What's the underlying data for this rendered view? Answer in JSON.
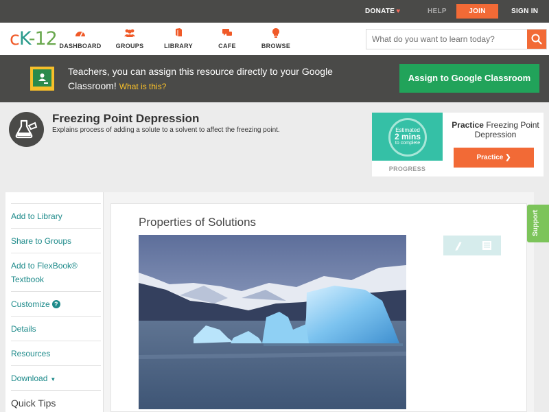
{
  "topbar": {
    "donate": "DONATE",
    "help": "HELP",
    "join": "JOIN",
    "sign_in": "SIGN IN"
  },
  "header": {
    "logo": {
      "c": "c",
      "k": "K",
      "dash": "-",
      "num": "12"
    },
    "nav": [
      {
        "label": "DASHBOARD",
        "icon": "dashboard-icon"
      },
      {
        "label": "GROUPS",
        "icon": "groups-icon"
      },
      {
        "label": "LIBRARY",
        "icon": "library-icon"
      },
      {
        "label": "CAFE",
        "icon": "cafe-icon"
      },
      {
        "label": "BROWSE",
        "icon": "browse-icon"
      }
    ],
    "search_placeholder": "What do you want to learn today?"
  },
  "classroom_banner": {
    "text": "Teachers, you can assign this resource directly to your Google Classroom!",
    "link": "What is this?",
    "button": "Assign to Google Classroom"
  },
  "concept": {
    "title": "Freezing Point Depression",
    "description": "Explains process of adding a solute to a solvent to affect the freezing point."
  },
  "practice": {
    "estimated": "Estimated",
    "minutes": "2 mins",
    "to_complete": "to complete",
    "progress_label": "PROGRESS",
    "title_bold": "Practice",
    "title_rest": "Freezing Point Depression",
    "button": "Practice"
  },
  "sidebar": {
    "items": [
      {
        "label": "Add to Library"
      },
      {
        "label": "Share to Groups"
      },
      {
        "label": "Add to FlexBook® Textbook"
      },
      {
        "label": "Customize"
      },
      {
        "label": "Details"
      },
      {
        "label": "Resources"
      },
      {
        "label": "Download"
      }
    ],
    "quick_tips": "Quick Tips"
  },
  "content": {
    "section_title": "Properties of Solutions"
  },
  "support": "Support",
  "colors": {
    "accent": "#f26a36",
    "teal": "#1d8a8a",
    "green": "#21a35a",
    "dark": "#4a4a48"
  }
}
